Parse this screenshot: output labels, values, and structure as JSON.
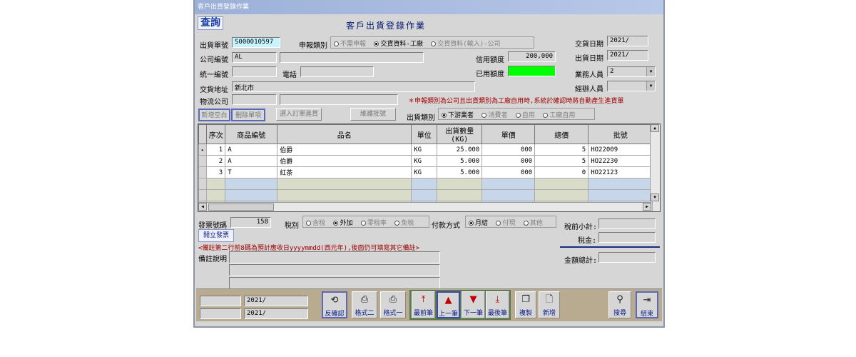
{
  "window": {
    "title": "客戶出貨登錄作業",
    "heading": "客戶出貨登錄作業",
    "query_label": "查詢"
  },
  "form": {
    "ship_no_label": "出貨單號",
    "ship_no": "S000010597",
    "report_type_label": "申報類別",
    "report_types": [
      "不需申報",
      "交貨資料-工廠",
      "交貨資料(輸入)-公司"
    ],
    "report_type_selected": 1,
    "delivery_date_label": "交貨日期",
    "delivery_date": "2021/",
    "company_no_label": "公司編號",
    "company_no": "AL",
    "company_name": "",
    "credit_label": "信用額度",
    "credit": "200,000",
    "ship_date_label": "出貨日期",
    "ship_date": "2021/",
    "tax_id_label": "統一編號",
    "tax_id": "",
    "phone_label": "電話",
    "phone": "",
    "used_credit_label": "已用額度",
    "used_credit": "",
    "sales_label": "業務人員",
    "sales": "2",
    "address_label": "交貨地址",
    "address": "新北市",
    "handler_label": "經辦人員",
    "handler": "",
    "logistics_label": "物流公司",
    "logistics_code": "",
    "logistics_name": "",
    "warning": "＊申報類別為公司且出貨類別為工廠自用時,系統於確認時將自動產生進貨單",
    "btn_new_empty": "新增空白",
    "btn_delete_row": "刪除單項",
    "btn_import_po": "選入訂單進貨",
    "btn_batch": "維護批號",
    "ship_type_label": "出貨類別",
    "ship_types": [
      "下游業者",
      "消費者",
      "自用",
      "工廠自用"
    ],
    "ship_type_selected": 0
  },
  "grid": {
    "columns": [
      "序次",
      "商品編號",
      "品名",
      "單位",
      "出貨數量(KG)",
      "單價",
      "總價",
      "批號"
    ],
    "rows": [
      {
        "seq": "1",
        "code": "A",
        "name": "伯爵",
        "unit": "KG",
        "qty": "25.000",
        "price": "000",
        "total": "5",
        "lot": "HO22009"
      },
      {
        "seq": "2",
        "code": "A",
        "name": "伯爵",
        "unit": "KG",
        "qty": "5.000",
        "price": "000",
        "total": "5",
        "lot": "HO22230"
      },
      {
        "seq": "3",
        "code": "T",
        "name": "紅茶",
        "unit": "KG",
        "qty": "5.000",
        "price": "000",
        "total": "0",
        "lot": "HO22123"
      }
    ]
  },
  "footer": {
    "invoice_no_label": "發票號碼",
    "invoice_no": "158",
    "tax_label": "稅別",
    "tax_types": [
      "含稅",
      "外加",
      "零稅率",
      "免稅"
    ],
    "tax_selected": 1,
    "pay_label": "付款方式",
    "pay_types": [
      "月結",
      "付現",
      "其他"
    ],
    "pay_selected": 0,
    "subtotal_label": "稅前小計:",
    "subtotal": "",
    "tax_amount_label": "稅金:",
    "tax_amount": "",
    "open_invoice": "開立發票",
    "note_hint": "<備註第二行前8碼為預計應收日yyyymmdd(西元年),後面仍可填寫其它備註>",
    "note_label": "備註說明",
    "grand_total_label": "金額總計:",
    "grand_total": "",
    "date1": "2021/",
    "date2": "2021/"
  },
  "toolbar": {
    "unconfirm": "反確認",
    "format2": "格式二",
    "format1": "格式一",
    "first": "最前筆",
    "prev": "上一筆",
    "next": "下一筆",
    "last": "最後筆",
    "copy": "複製",
    "add": "新增",
    "search": "搜尋",
    "exit": "結束"
  },
  "colors": {
    "title_bar": "#9cb0d8",
    "window_bg": "#d6d6d6",
    "heading": "#001a70",
    "warning": "#a00000",
    "used_credit": "#00ff00",
    "bottom_bar": "#b8ab90"
  }
}
